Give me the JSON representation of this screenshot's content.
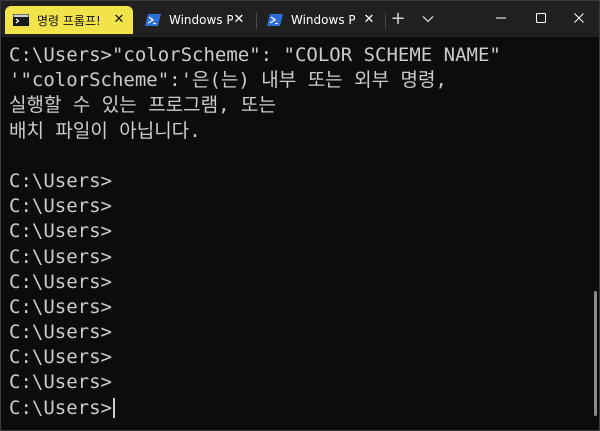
{
  "tabs": [
    {
      "label": "명령 프롬프!",
      "icon": "cmd-icon",
      "active": true
    },
    {
      "label": "Windows Po",
      "icon": "powershell-icon",
      "active": false
    },
    {
      "label": "Windows Po",
      "icon": "powershell-icon",
      "active": false
    }
  ],
  "titlebar": {
    "new_tab": "+",
    "close_glyph": "✕"
  },
  "terminal": {
    "lines": [
      "C:\\Users>\"colorScheme\": \"COLOR SCHEME NAME\"",
      "'\"colorScheme\":'은(는) 내부 또는 외부 명령,",
      "실행할 수 있는 프로그램, 또는",
      "배치 파일이 아닙니다.",
      "",
      "C:\\Users>",
      "C:\\Users>",
      "C:\\Users>",
      "C:\\Users>",
      "C:\\Users>",
      "C:\\Users>",
      "C:\\Users>",
      "C:\\Users>",
      "C:\\Users>",
      "C:\\Users>"
    ]
  },
  "colors": {
    "accent_tab": "#f3e34a",
    "titlebar": "#202020",
    "terminal_bg": "#0c0c0c",
    "terminal_fg": "#cccccc"
  }
}
